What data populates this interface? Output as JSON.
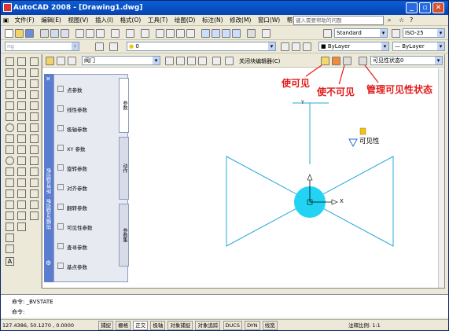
{
  "window": {
    "title": "AutoCAD 2008 - [Drawing1.dwg]",
    "minimize_glyph": "_",
    "restore_glyph": "▫",
    "close_glyph": "✕"
  },
  "menubar": {
    "items": [
      "文件(F)",
      "编辑(E)",
      "视图(V)",
      "插入(I)",
      "格式(O)",
      "工具(T)",
      "绘图(D)",
      "标注(N)",
      "修改(M)",
      "窗口(W)",
      "帮助(H)"
    ],
    "search_placeholder": "键入需要帮助的问题"
  },
  "toolbar": {
    "text_style": "Standard",
    "dim_style": "ISO-25",
    "layer": "0",
    "color": "ByLayer",
    "linetype": "ByLayer",
    "workspace_hint": "ng"
  },
  "block_editor": {
    "block_name": "阀门",
    "close_label": "关闭块编辑器(C)",
    "visibility_state": "可见性状态0"
  },
  "annotations": {
    "make_visible": "使可见",
    "make_invisible": "使不可见",
    "manage_states": "管理可见性状态",
    "color": "#e21b1b"
  },
  "palette": {
    "side_title": "块编写选项板 - 所有选项板",
    "items": [
      "点参数",
      "线性参数",
      "极轴参数",
      "XY 参数",
      "旋转参数",
      "对齐参数",
      "翻转参数",
      "可见性参数",
      "查寻参数",
      "基点参数"
    ],
    "tabs": [
      "参数",
      "动作",
      "参数集"
    ]
  },
  "drawing": {
    "visibility_label": "可见性",
    "x_axis": "X",
    "y_axis": "Y",
    "circle_color": "#22d3f3"
  },
  "command": {
    "line1": "命令: _BVSTATE",
    "line2": "命令:"
  },
  "status": {
    "coords": "127.4386,  50.1270 , 0.0000",
    "buttons": [
      "捕捉",
      "栅格",
      "正交",
      "极轴",
      "对象捕捉",
      "对象追踪",
      "DUCS",
      "DYN",
      "线宽"
    ],
    "scale": "注释比例: 1:1"
  }
}
